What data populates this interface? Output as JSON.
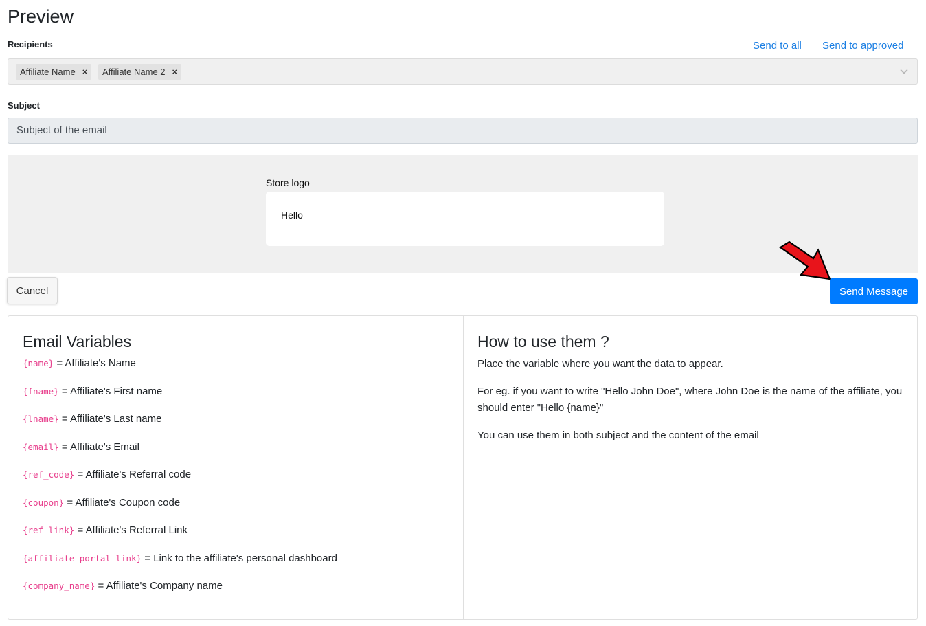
{
  "page": {
    "title": "Preview"
  },
  "recipients": {
    "label": "Recipients",
    "send_to_all": "Send to all",
    "send_to_approved": "Send to approved",
    "tags": [
      {
        "name": "Affiliate Name",
        "remove": "×"
      },
      {
        "name": "Affiliate Name 2",
        "remove": "×"
      }
    ]
  },
  "subject": {
    "label": "Subject",
    "value": "Subject of the email"
  },
  "email_preview": {
    "store_logo": "Store logo",
    "body": "Hello"
  },
  "actions": {
    "cancel": "Cancel",
    "send": "Send Message"
  },
  "variables": {
    "title": "Email Variables",
    "items": [
      {
        "code": "{name}",
        "desc": "= Affiliate's Name"
      },
      {
        "code": "{fname}",
        "desc": "= Affiliate's First name"
      },
      {
        "code": "{lname}",
        "desc": "= Affiliate's Last name"
      },
      {
        "code": "{email}",
        "desc": "= Affiliate's Email"
      },
      {
        "code": "{ref_code}",
        "desc": "= Affiliate's Referral code"
      },
      {
        "code": "{coupon}",
        "desc": "= Affiliate's Coupon code"
      },
      {
        "code": "{ref_link}",
        "desc": "= Affiliate's Referral Link"
      },
      {
        "code": "{affiliate_portal_link}",
        "desc": "= Link to the affiliate's personal dashboard"
      },
      {
        "code": "{company_name}",
        "desc": "= Affiliate's Company name"
      }
    ]
  },
  "how_to": {
    "title": "How to use them ?",
    "paragraphs": [
      "Place the variable where you want the data to appear.",
      "For eg. if you want to write \"Hello John Doe\", where John Doe is the name of the affiliate, you should enter \"Hello {name}\"",
      "You can use them in both subject and the content of the email"
    ]
  },
  "colors": {
    "link": "#1a7ee3",
    "primary_button": "#007bff",
    "variable_code": "#e83e8c",
    "annotation_arrow": "#e8141b"
  },
  "icons": {
    "dropdown": "chevron-down-icon",
    "remove_tag": "close-icon",
    "annotation": "red-arrow-icon"
  }
}
